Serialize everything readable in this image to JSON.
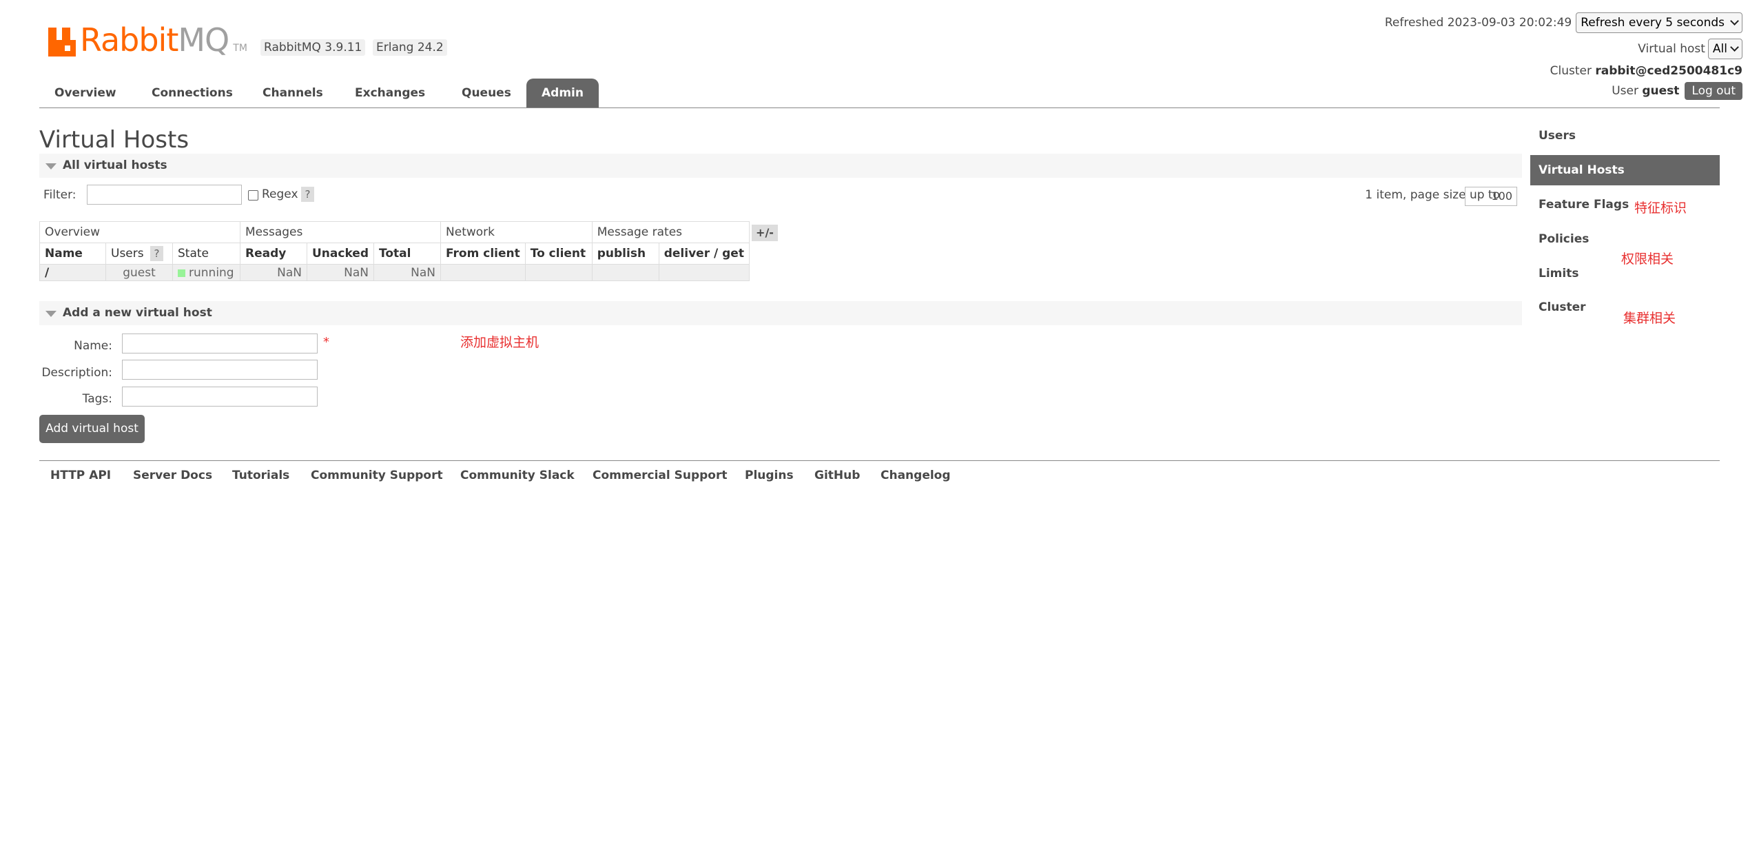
{
  "header": {
    "logo": {
      "rabbit": "Rabbit",
      "mq": "MQ",
      "tm": "TM"
    },
    "version_badge": "RabbitMQ 3.9.11",
    "erlang_badge": "Erlang 24.2",
    "refreshed_text": "Refreshed 2023-09-03 20:02:49",
    "refresh_select": "Refresh every 5 seconds",
    "vhost_label": "Virtual host",
    "vhost_select": "All",
    "cluster_label": "Cluster",
    "cluster_value": "rabbit@ced2500481c9",
    "user_label": "User",
    "user_value": "guest",
    "logout_label": "Log out"
  },
  "tabs": [
    {
      "label": "Overview"
    },
    {
      "label": "Connections"
    },
    {
      "label": "Channels"
    },
    {
      "label": "Exchanges"
    },
    {
      "label": "Queues"
    },
    {
      "label": "Admin"
    }
  ],
  "page_title": "Virtual Hosts",
  "all_vhosts": {
    "section_title": "All virtual hosts",
    "filter_label": "Filter:",
    "filter_value": "",
    "regex_label": "Regex",
    "help_glyph": "?",
    "page_size_text": "1 item, page size up to",
    "page_size_value": "100",
    "plus_minus": "+/-",
    "groups": [
      "Overview",
      "Messages",
      "Network",
      "Message rates"
    ],
    "columns": [
      "Name",
      "Users",
      "State",
      "Ready",
      "Unacked",
      "Total",
      "From client",
      "To client",
      "publish",
      "deliver / get"
    ],
    "rows": [
      {
        "name": "/",
        "users": "guest",
        "state": "running",
        "ready": "NaN",
        "unacked": "NaN",
        "total": "NaN",
        "from_client": "",
        "to_client": "",
        "publish": "",
        "deliver_get": ""
      }
    ]
  },
  "add_vhost": {
    "section_title": "Add a new virtual host",
    "name_label": "Name:",
    "description_label": "Description:",
    "tags_label": "Tags:",
    "required_mark": "*",
    "submit_label": "Add virtual host"
  },
  "footer": {
    "links": [
      "HTTP API",
      "Server Docs",
      "Tutorials",
      "Community Support",
      "Community Slack",
      "Commercial Support",
      "Plugins",
      "GitHub",
      "Changelog"
    ]
  },
  "sidebar": {
    "items": [
      "Users",
      "Virtual Hosts",
      "Feature Flags",
      "Policies",
      "Limits",
      "Cluster"
    ]
  },
  "annotations": {
    "feature_flags": "特征标识",
    "permissions": "权限相关",
    "cluster": "集群相关",
    "add_vhost": "添加虚拟主机"
  }
}
